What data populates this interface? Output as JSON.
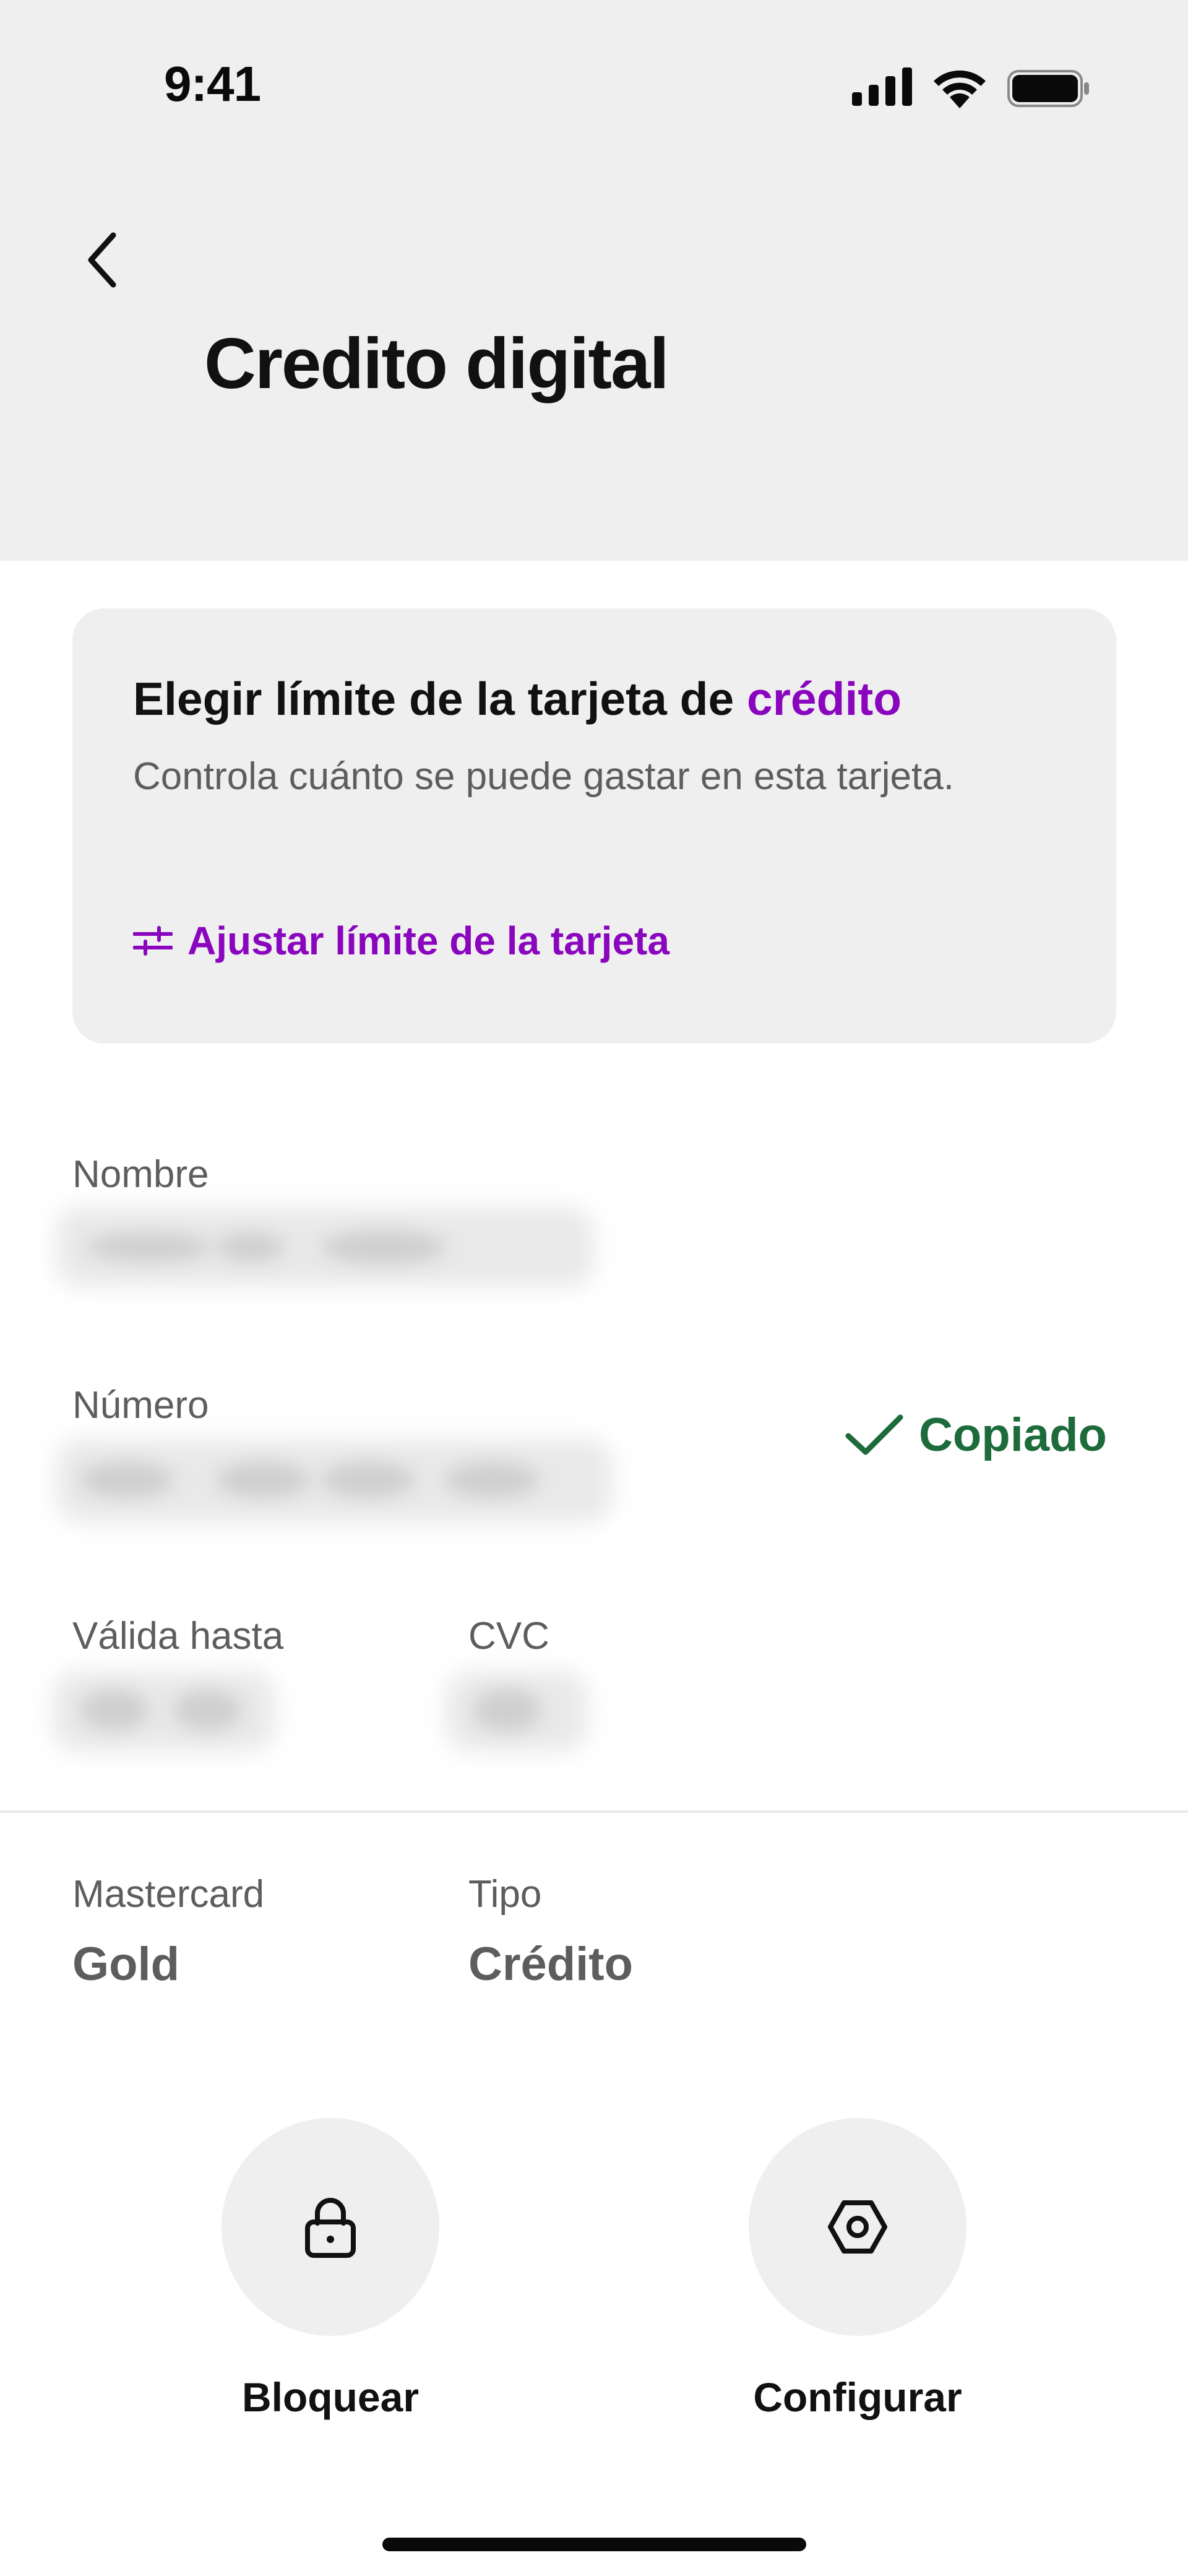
{
  "status_bar": {
    "time": "9:41",
    "icons": [
      "signal-icon",
      "wifi-icon",
      "battery-icon"
    ]
  },
  "header": {
    "back_icon": "chevron-left-icon",
    "title": "Credito digital"
  },
  "limit_card": {
    "title": "Elegir límite de la tarjeta de ",
    "title_accent": "crédito",
    "description": "Controla cuánto se puede gastar en esta tarjeta.",
    "link_icon": "sliders-icon",
    "link_label": "Ajustar límite de la tarjeta"
  },
  "card_details": {
    "name_label": "Nombre",
    "number_label": "Número",
    "copied_label": "Copiado",
    "valid_label": "Válida hasta",
    "cvc_label": "CVC",
    "brand_label": "Mastercard",
    "brand_value": "Gold",
    "type_label": "Tipo",
    "type_value": "Crédito"
  },
  "actions": [
    {
      "label": "Bloquear",
      "icon": "lock-icon"
    },
    {
      "label": "Configurar",
      "icon": "settings-icon"
    }
  ],
  "colors": {
    "accent": "#8a05be",
    "success": "#1d6b3a",
    "header_bg": "#efefef"
  }
}
